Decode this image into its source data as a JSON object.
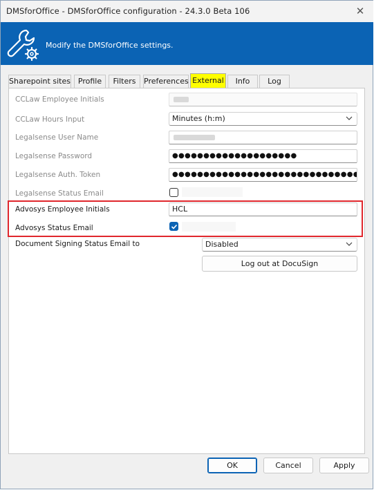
{
  "window": {
    "title": "DMSforOffice - DMSforOffice configuration - 24.3.0 Beta 106",
    "close_glyph": "✕"
  },
  "banner": {
    "icon": "wrench-gear-icon",
    "text": "Modify the DMSforOffice settings.",
    "color": "#0b63b4"
  },
  "tabs": [
    {
      "label": "Sharepoint sites",
      "active": false
    },
    {
      "label": "Profile",
      "active": false
    },
    {
      "label": "Filters",
      "active": false
    },
    {
      "label": "Preferences",
      "active": false
    },
    {
      "label": "External",
      "active": true
    },
    {
      "label": "Info",
      "active": false
    },
    {
      "label": "Log",
      "active": false
    }
  ],
  "form": {
    "cclaw_initials": {
      "label": "CCLaw Employee Initials",
      "value": ""
    },
    "cclaw_hours": {
      "label": "CCLaw Hours Input",
      "value": "Minutes  (h:m)"
    },
    "legalsense_user": {
      "label": "Legalsense User Name",
      "value": ""
    },
    "legalsense_password": {
      "label": "Legalsense Password",
      "value": "●●●●●●●●●●●●●●●●●●●●"
    },
    "legalsense_token": {
      "label": "Legalsense Auth. Token",
      "value": "●●●●●●●●●●●●●●●●●●●●●●●●●●●●●●●●●●●●●●"
    },
    "legalsense_status_email": {
      "label": "Legalsense Status Email",
      "checked": false
    },
    "advosys_initials": {
      "label": "Advosys Employee Initials",
      "value": "HCL"
    },
    "advosys_status_email": {
      "label": "Advosys Status Email",
      "checked": true
    },
    "doc_signing_status": {
      "label": "Document Signing Status Email to",
      "value": "Disabled"
    },
    "docusign_logout": {
      "label": "Log out at DocuSign"
    }
  },
  "highlight_color": "#e0262c",
  "active_tab_color": "#ffff00",
  "buttons": {
    "ok": "OK",
    "cancel": "Cancel",
    "apply": "Apply"
  }
}
